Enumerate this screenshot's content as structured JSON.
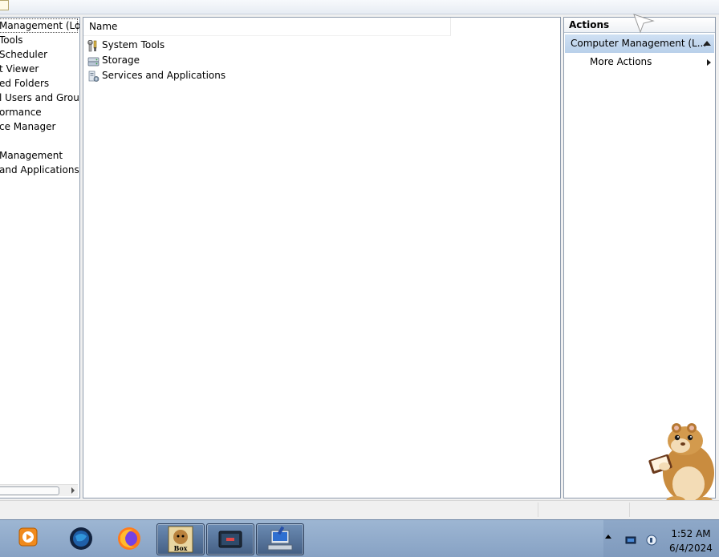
{
  "tree": {
    "items": [
      {
        "label": "Management (Local"
      },
      {
        "label": "Tools"
      },
      {
        "label": "Scheduler"
      },
      {
        "label": "t Viewer"
      },
      {
        "label": "ed Folders"
      },
      {
        "label": "l Users and Groups"
      },
      {
        "label": "ormance"
      },
      {
        "label": "ce Manager"
      },
      {
        "label": "Management"
      },
      {
        "label": "and Applications"
      }
    ]
  },
  "list": {
    "column_name": "Name",
    "items": [
      {
        "label": "System Tools",
        "icon": "tools-icon"
      },
      {
        "label": "Storage",
        "icon": "storage-icon"
      },
      {
        "label": "Services and Applications",
        "icon": "services-icon"
      }
    ]
  },
  "actions": {
    "header": "Actions",
    "section_label": "Computer Management (L...",
    "more_actions": "More Actions"
  },
  "taskbar": {
    "clock_time": "1:52 AM",
    "clock_date": "6/4/2024",
    "apps": [
      "media-player-icon",
      "globe-icon",
      "firefox-icon",
      "sandboxie-icon",
      "terminal-icon",
      "computer-management-icon"
    ]
  },
  "colors": {
    "action_section_bg": "#c2d6ee",
    "taskbar_bg": "#95aecd",
    "panel_border": "#8e9bad"
  }
}
